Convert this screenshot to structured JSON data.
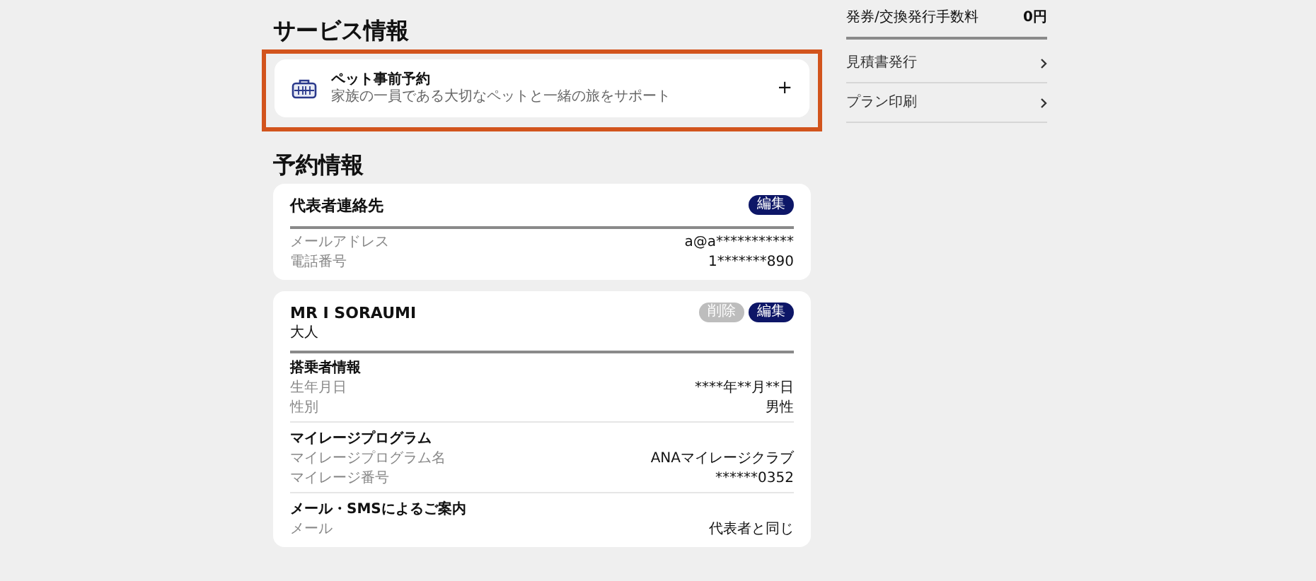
{
  "service_section": {
    "title": "サービス情報",
    "highlighted": true,
    "items": [
      {
        "title": "ペット事前予約",
        "description": "家族の一員である大切なペットと一緒の旅をサポート",
        "action": "+"
      }
    ]
  },
  "reservation_section": {
    "title": "予約情報",
    "cards": [
      {
        "title": "代表者連絡先",
        "buttons": [
          {
            "label": "編集",
            "kind": "primary"
          }
        ],
        "groups": [
          {
            "rows": [
              {
                "label": "メールアドレス",
                "value": "a@a***********"
              },
              {
                "label": "電話番号",
                "value": "1*******890"
              }
            ]
          }
        ]
      },
      {
        "title": "MR I SORAUMI",
        "subtitle": "大人",
        "buttons": [
          {
            "label": "削除",
            "kind": "secondary"
          },
          {
            "label": "編集",
            "kind": "primary"
          }
        ],
        "groups": [
          {
            "heading": "搭乗者情報",
            "rows": [
              {
                "label": "生年月日",
                "value": "****年**月**日"
              },
              {
                "label": "性別",
                "value": "男性"
              }
            ]
          },
          {
            "heading": "マイレージプログラム",
            "rows": [
              {
                "label": "マイレージプログラム名",
                "value": "ANAマイレージクラブ"
              },
              {
                "label": "マイレージ番号",
                "value": "******0352"
              }
            ]
          },
          {
            "heading": "メール・SMSによるご案内",
            "rows": [
              {
                "label": "メール",
                "value": "代表者と同じ"
              }
            ]
          }
        ]
      }
    ]
  },
  "sidebar": {
    "fee_row": {
      "label": "発券/交換発行手数料",
      "value": "0円"
    },
    "links": [
      {
        "label": "見積書発行"
      },
      {
        "label": "プラン印刷"
      }
    ]
  }
}
